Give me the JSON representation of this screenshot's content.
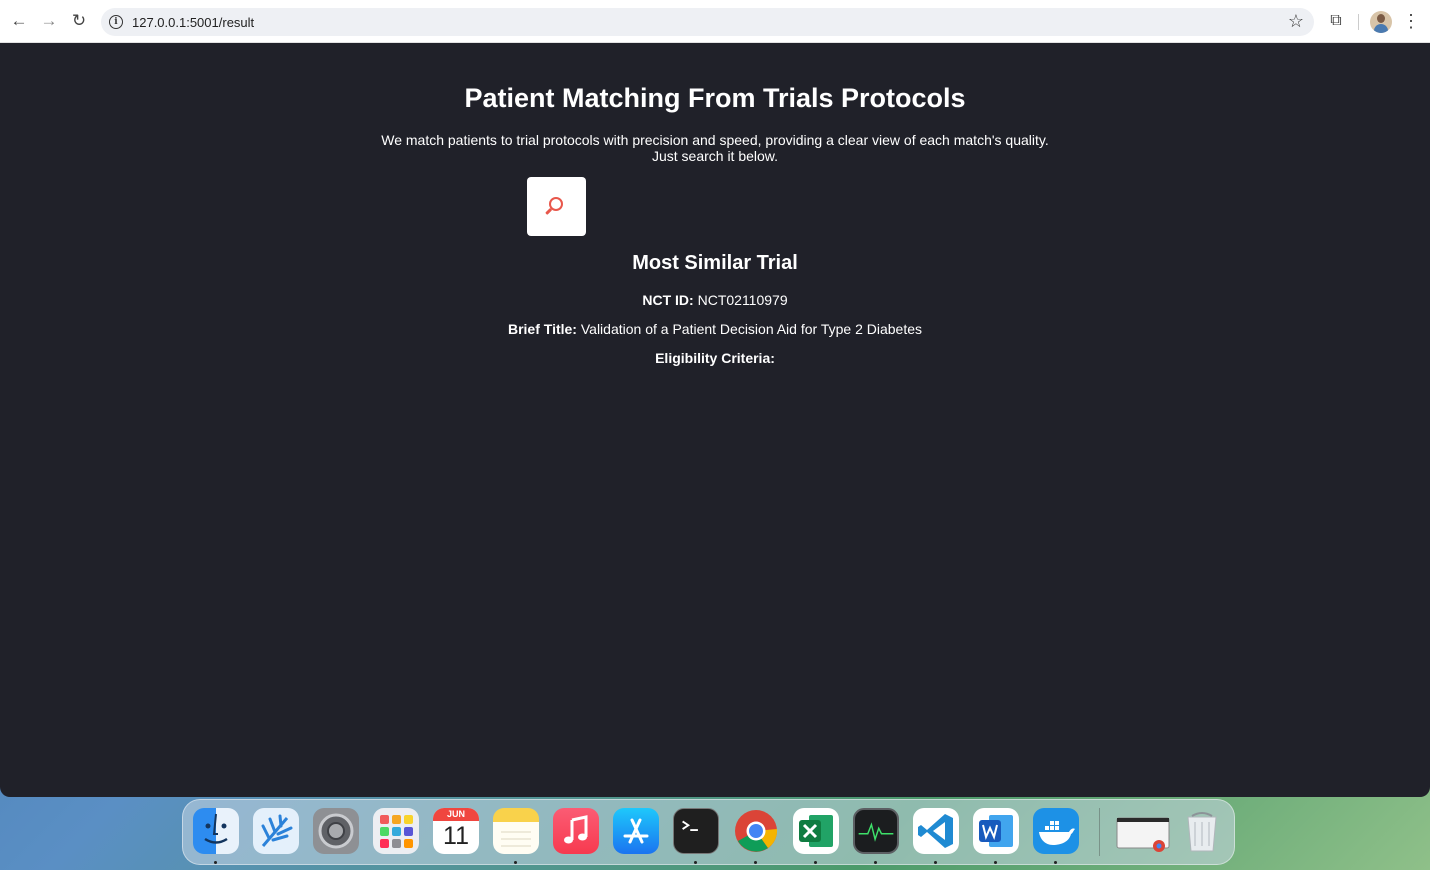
{
  "browser": {
    "url": "127.0.0.1:5001/result",
    "back_glyph": "←",
    "forward_glyph": "→",
    "reload_glyph": "↻",
    "info_glyph": "i",
    "star_glyph": "☆",
    "extensions_glyph": "⧉",
    "menu_glyph": "⋮"
  },
  "page": {
    "title": "Patient Matching From Trials Protocols",
    "subtitle": "We match patients to trial protocols with precision and speed, providing a clear view of each match's quality. Just search it below.",
    "section_title": "Most Similar Trial",
    "nct_label": "NCT ID:",
    "nct_value": "NCT02110979",
    "brief_title_label": "Brief Title:",
    "brief_title_value": "Validation of a Patient Decision Aid for Type 2 Diabetes",
    "eligibility_label": "Eligibility Criteria:",
    "background_color": "#202129",
    "search_icon_color": "#e8574b"
  },
  "dock": {
    "calendar_month": "JUN",
    "calendar_day": "11",
    "items": [
      {
        "name": "finder-icon"
      },
      {
        "name": "wheat-app-icon"
      },
      {
        "name": "system-settings-icon"
      },
      {
        "name": "launchpad-icon"
      },
      {
        "name": "calendar-icon"
      },
      {
        "name": "notes-icon"
      },
      {
        "name": "music-icon"
      },
      {
        "name": "app-store-icon"
      },
      {
        "name": "terminal-icon"
      },
      {
        "name": "chrome-icon"
      },
      {
        "name": "excel-icon"
      },
      {
        "name": "activity-monitor-icon"
      },
      {
        "name": "vscode-icon"
      },
      {
        "name": "word-icon"
      },
      {
        "name": "docker-icon"
      },
      {
        "name": "chrome-window-icon"
      },
      {
        "name": "trash-icon"
      }
    ]
  }
}
